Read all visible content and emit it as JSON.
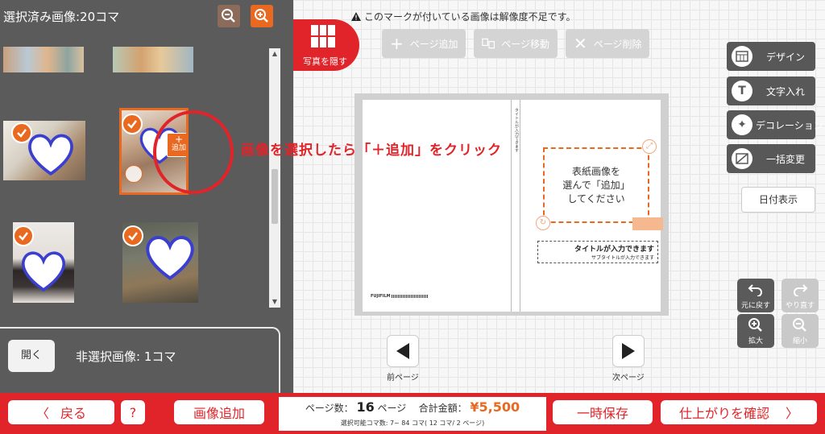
{
  "left_panel": {
    "title": "選択済み画像:20コマ",
    "open_button": "開く",
    "unselected_label": "非選択画像: 1コマ",
    "add_badge_label": "追加"
  },
  "annotation": {
    "text": "画像を選択したら「＋追加」をクリック"
  },
  "editor": {
    "notice": "このマークが付いている画像は解像度不足です。",
    "hide_photos_label": "写真を隠す",
    "page_tools": {
      "add": "ページ追加",
      "move": "ページ移動",
      "delete": "ページ削除"
    },
    "cover_placeholder": [
      "表紙画像を",
      "選んで「追加」",
      "してください"
    ],
    "title_placeholder": "タイトルが入力できます",
    "subtitle_placeholder": "サブタイトルが入力できます",
    "brand": "FUJIFILM",
    "prev_page": "前ページ",
    "next_page": "次ページ"
  },
  "right_tools": {
    "design": "デザイン",
    "text_input": "文字入れ",
    "decoration": "デコレーション",
    "bulk_change": "一括変更",
    "date_display": "日付表示",
    "undo": "元に戻す",
    "redo": "やり直す",
    "zoom_in": "拡大",
    "zoom_out": "縮小"
  },
  "bottom_bar": {
    "back": "戻る",
    "help": "?",
    "add_images": "画像追加",
    "page_count_label": "ページ数：",
    "page_count": "16",
    "page_unit": "ページ",
    "total_label": "合計金額：",
    "total_price": "¥5,500",
    "selectable_info": "選択可能コマ数: 7~ 84 コマ( 12 コマ/ 2 ページ)",
    "save": "一時保存",
    "confirm": "仕上がりを確認"
  },
  "colors": {
    "brand_red": "#e0242a",
    "accent_orange": "#e8691f",
    "heart_blue": "#3b3fd0",
    "panel_gray": "#5b5b5b"
  }
}
